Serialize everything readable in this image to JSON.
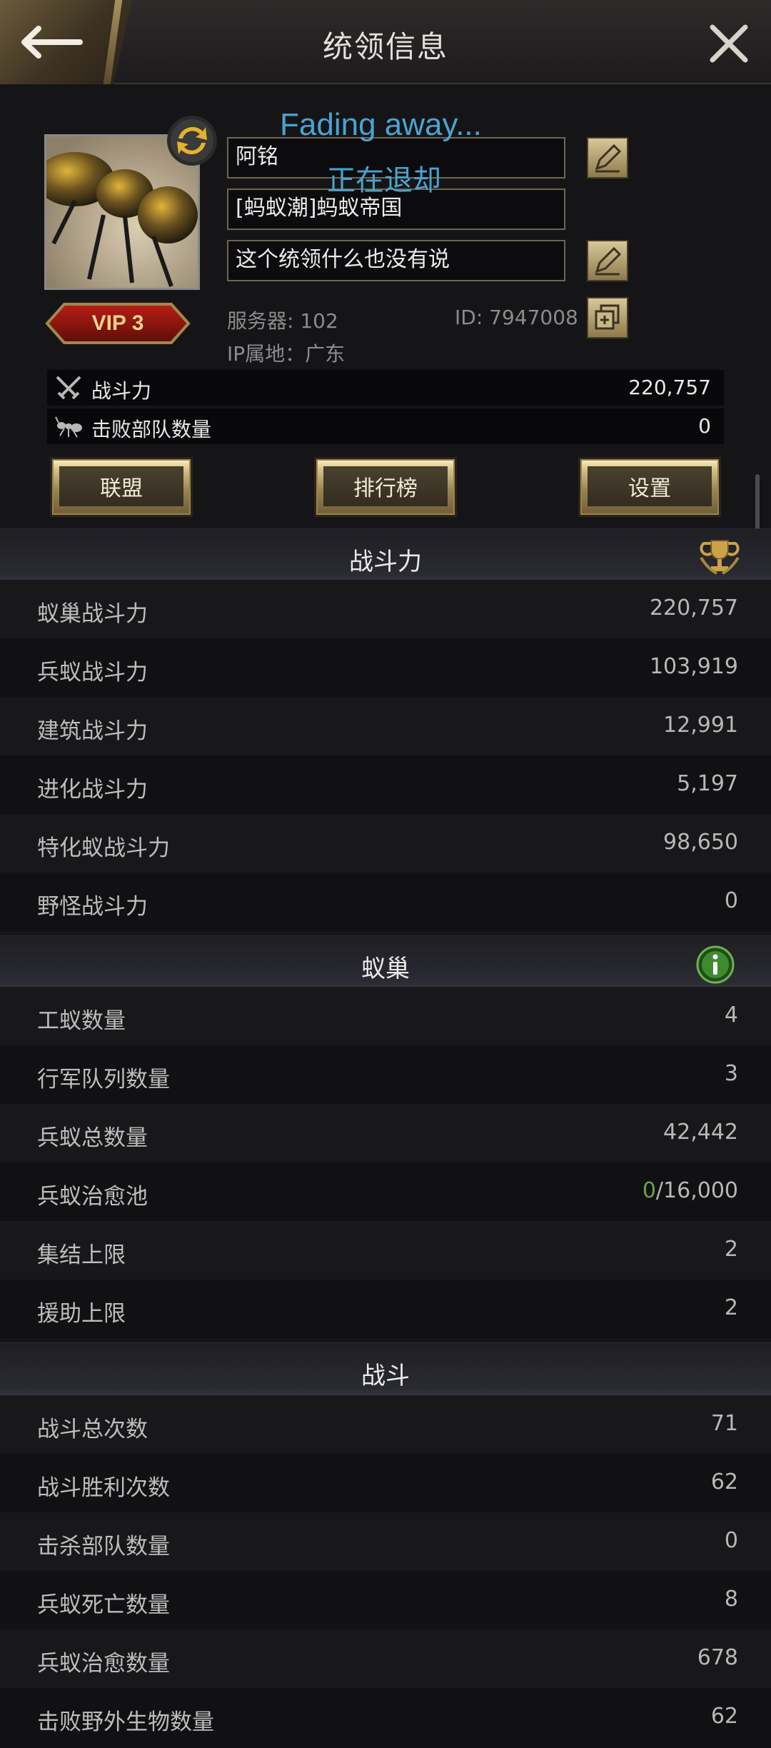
{
  "header": {
    "title": "统领信息"
  },
  "profile": {
    "name": "阿铭",
    "alliance": "[蚂蚁潮]蚂蚁帝国",
    "signature": "这个统领什么也没有说",
    "vip": "VIP 3",
    "server": "服务器: 102",
    "id": "ID: 7947008",
    "ip": "IP属地：广东",
    "overlay_en": "Fading away...",
    "overlay_cn": "正在退却"
  },
  "summary": [
    {
      "label": "战斗力",
      "value": "220,757",
      "icon": "crossed-swords-icon"
    },
    {
      "label": "击败部队数量",
      "value": "0",
      "icon": "ant-icon"
    }
  ],
  "buttons": {
    "alliance": "联盟",
    "ranking": "排行榜",
    "settings": "设置"
  },
  "sections": {
    "power": {
      "title": "战斗力",
      "icon": "trophy-icon",
      "rows": [
        {
          "label": "蚁巢战斗力",
          "value": "220,757"
        },
        {
          "label": "兵蚁战斗力",
          "value": "103,919"
        },
        {
          "label": "建筑战斗力",
          "value": "12,991"
        },
        {
          "label": "进化战斗力",
          "value": "5,197"
        },
        {
          "label": "特化蚁战斗力",
          "value": "98,650"
        },
        {
          "label": "野怪战斗力",
          "value": "0"
        }
      ]
    },
    "nest": {
      "title": "蚁巢",
      "icon": "info-icon",
      "rows": [
        {
          "label": "工蚁数量",
          "value": "4"
        },
        {
          "label": "行军队列数量",
          "value": "3"
        },
        {
          "label": "兵蚁总数量",
          "value": "42,442"
        },
        {
          "label": "兵蚁治愈池",
          "value_current": "0",
          "value_max": "/16,000"
        },
        {
          "label": "集结上限",
          "value": "2"
        },
        {
          "label": "援助上限",
          "value": "2"
        }
      ]
    },
    "battle": {
      "title": "战斗",
      "rows": [
        {
          "label": "战斗总次数",
          "value": "71"
        },
        {
          "label": "战斗胜利次数",
          "value": "62"
        },
        {
          "label": "击杀部队数量",
          "value": "0"
        },
        {
          "label": "兵蚁死亡数量",
          "value": "8"
        },
        {
          "label": "兵蚁治愈数量",
          "value": "678"
        },
        {
          "label": "击败野外生物数量",
          "value": "62"
        }
      ]
    }
  },
  "colors": {
    "accent_gold": "#c8b27a",
    "overlay_blue": "#4aa3cf",
    "heal_green": "#6aa24a"
  }
}
